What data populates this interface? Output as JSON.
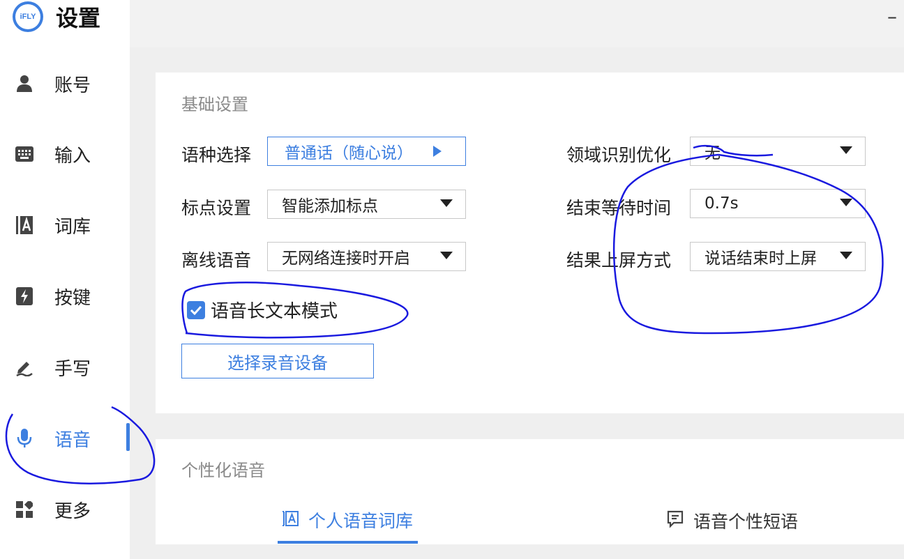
{
  "app": {
    "logo_text": "iFLY",
    "title": "设置",
    "minimize_symbol": "–"
  },
  "sidebar": {
    "items": [
      {
        "label": "账号",
        "icon": "user-icon"
      },
      {
        "label": "输入",
        "icon": "keyboard-icon"
      },
      {
        "label": "词库",
        "icon": "lexicon-icon"
      },
      {
        "label": "按键",
        "icon": "lightning-icon"
      },
      {
        "label": "手写",
        "icon": "pen-icon"
      },
      {
        "label": "语音",
        "icon": "microphone-icon",
        "active": true
      },
      {
        "label": "更多",
        "icon": "grid-icon"
      }
    ]
  },
  "basic": {
    "title": "基础设置",
    "language_label": "语种选择",
    "language_value": "普通话（随心说）",
    "punctuation_label": "标点设置",
    "punctuation_value": "智能添加标点",
    "offline_label": "离线语音",
    "offline_value": "无网络连接时开启",
    "domain_label": "领域识别优化",
    "domain_value": "无",
    "wait_label": "结束等待时间",
    "wait_value": "0.7s",
    "result_label": "结果上屏方式",
    "result_value": "说话结束时上屏",
    "long_text_label": "语音长文本模式",
    "long_text_checked": true,
    "select_device_button": "选择录音设备"
  },
  "personal": {
    "title": "个性化语音",
    "tabs": [
      {
        "label": "个人语音词库",
        "active": true
      },
      {
        "label": "语音个性短语",
        "active": false
      }
    ]
  },
  "colors": {
    "accent": "#3d7fe0",
    "annotation_ink": "#1a1adf"
  }
}
